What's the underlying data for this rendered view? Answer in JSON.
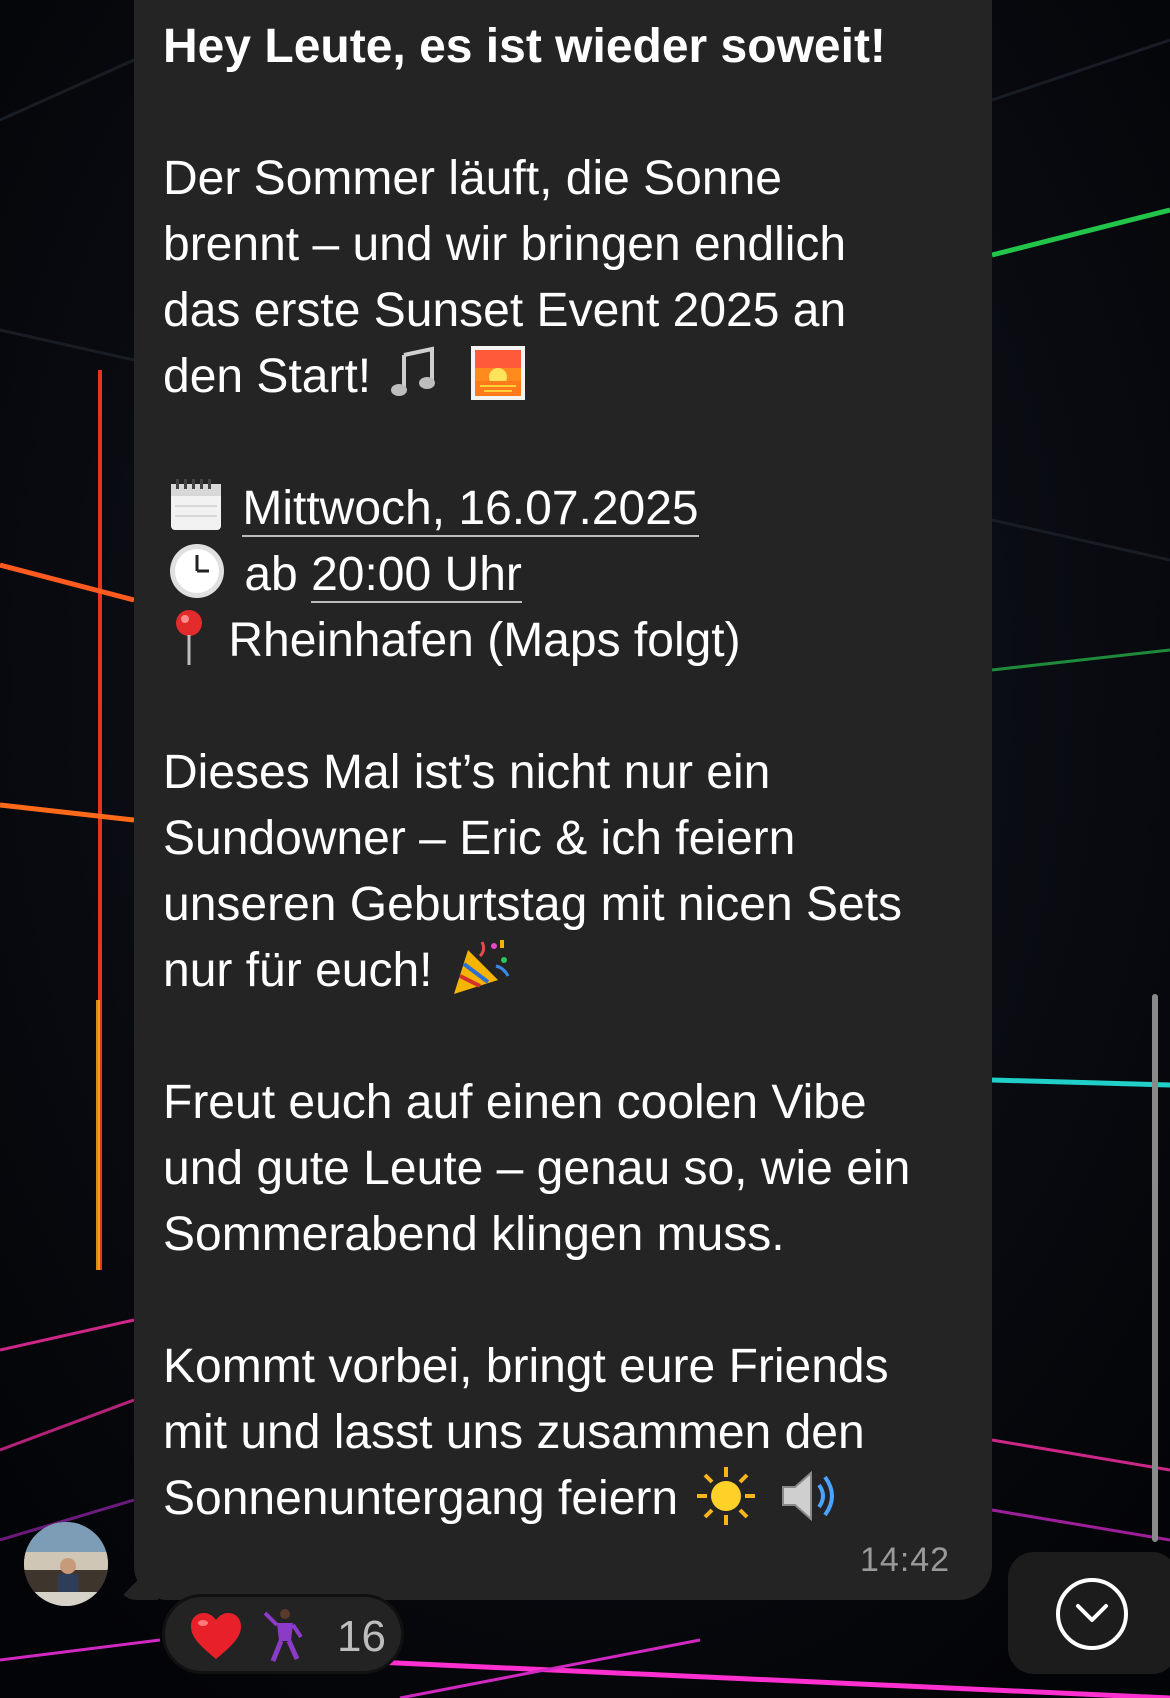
{
  "message": {
    "headline": "Hey Leute, es ist wieder soweit!",
    "intro_lines": [
      "Der Sommer läuft, die Sonne",
      "brennt – und wir bringen endlich",
      "das erste Sunset Event 2025 an",
      "den Start!"
    ],
    "date_text": "Mittwoch, 16.07.2025",
    "time_prefix": "ab",
    "time_text": "20:00 Uhr",
    "location_text": "Rheinhafen (Maps folgt)",
    "para2_lines": [
      "Dieses Mal ist’s nicht nur ein",
      "Sundowner – Eric & ich feiern",
      "unseren Geburtstag mit nicen Sets",
      "nur für euch!"
    ],
    "para3_lines": [
      "Freut euch auf einen coolen Vibe",
      "und gute Leute – genau so, wie ein",
      "Sommerabend klingen muss."
    ],
    "para4_lines": [
      "Kommt vorbei, bringt eure Friends",
      "mit und lasst uns zusammen den",
      "Sonnenuntergang feiern"
    ],
    "timestamp": "14:42",
    "emoji_icons": [
      "music-notes-icon",
      "sunset-icon",
      "calendar-icon",
      "clock-icon",
      "pin-icon",
      "party-popper-icon",
      "sun-icon",
      "speaker-icon"
    ]
  },
  "reactions": {
    "icons": [
      "red-heart-icon",
      "dancing-man-icon"
    ],
    "count": "16"
  },
  "colors": {
    "bubble": "#242424",
    "text": "#ffffff",
    "timestamp": "#9a9a9a",
    "background": "#05060a",
    "reaction_bg": "#232323"
  }
}
